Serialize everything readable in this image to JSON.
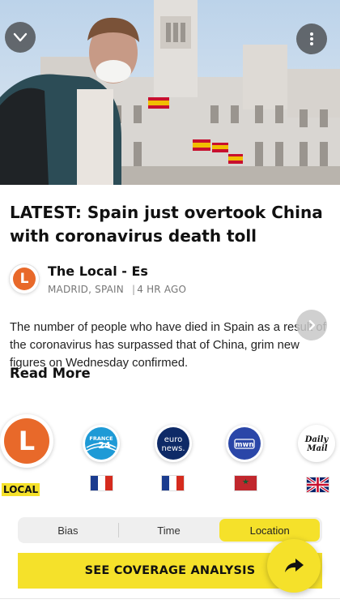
{
  "hero": {
    "collapse_icon": "chevron-down-icon",
    "more_icon": "more-vertical-icon"
  },
  "article": {
    "headline": "LATEST: Spain just overtook China with coronavirus death toll",
    "source_logo_letter": "L",
    "source_name": "The Local - Es",
    "location": "MADRID, SPAIN",
    "age": "4 HR AGO",
    "summary": "The number of people who have died in Spain as a result of the coronavirus has surpassed that of China, grim new figures on Wednesday confirmed.",
    "read_more": "Read More"
  },
  "outlets": [
    {
      "name": "The Local",
      "logo_text": "L",
      "flag": "France",
      "selected": true,
      "label": "LOCAL"
    },
    {
      "name": "France 24",
      "logo_text": "FRANCE 24",
      "flag": "France"
    },
    {
      "name": "Euronews",
      "logo_text": "euro news.",
      "flag": "France"
    },
    {
      "name": "Morocco World News",
      "logo_text": "mwn",
      "flag": "Morocco"
    },
    {
      "name": "Daily Mail",
      "logo_text": "Daily Mail",
      "flag": "UK"
    }
  ],
  "filters": {
    "tabs": [
      "Bias",
      "Time",
      "Location"
    ],
    "active": "Location"
  },
  "actions": {
    "coverage_label": "SEE COVERAGE ANALYSIS",
    "share_icon": "share-arrow-icon"
  },
  "colors": {
    "accent_yellow": "#f5e12a",
    "local_orange": "#e8692a",
    "france24_blue": "#1e9ad6",
    "euronews_navy": "#0e2a67",
    "mwn_blue": "#2a46a8"
  }
}
